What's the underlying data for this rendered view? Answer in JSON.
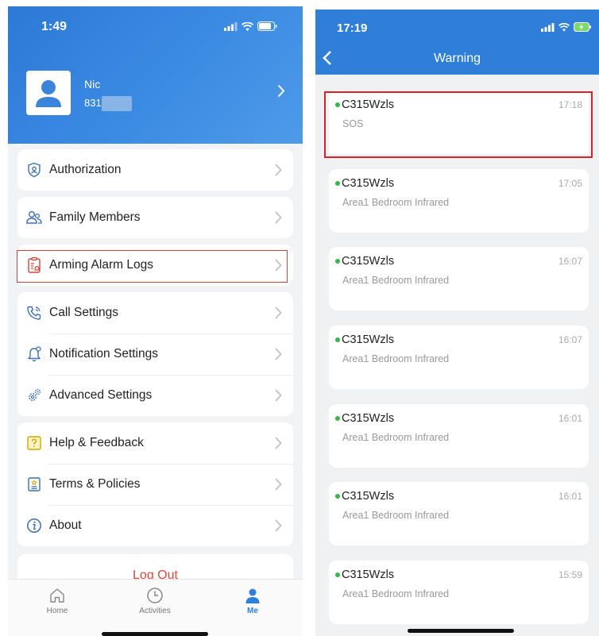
{
  "left": {
    "status_time": "1:49",
    "profile": {
      "name": "Nic",
      "id": "831"
    },
    "menu": [
      {
        "label": "Authorization",
        "icon": "shield-user-icon"
      },
      {
        "label": "Family Members",
        "icon": "family-icon"
      },
      {
        "label": "Arming Alarm Logs",
        "icon": "alarm-log-icon"
      },
      {
        "label": "Call Settings",
        "icon": "phone-icon"
      },
      {
        "label": "Notification Settings",
        "icon": "bell-icon"
      },
      {
        "label": "Advanced Settings",
        "icon": "gears-icon"
      },
      {
        "label": "Help & Feedback",
        "icon": "help-icon"
      },
      {
        "label": "Terms & Policies",
        "icon": "document-icon"
      },
      {
        "label": "About",
        "icon": "info-icon"
      }
    ],
    "logout": "Log Out",
    "tabs": [
      {
        "label": "Home",
        "icon": "home-icon"
      },
      {
        "label": "Activities",
        "icon": "clock-icon"
      },
      {
        "label": "Me",
        "icon": "person-icon"
      }
    ],
    "colors": {
      "brand": "#2f7ed8",
      "highlight": "#d8413a",
      "logout": "#e0463c"
    }
  },
  "right": {
    "status_time": "17:19",
    "title": "Warning",
    "warnings": [
      {
        "device": "C315Wzls",
        "time": "17:18",
        "desc": "SOS"
      },
      {
        "device": "C315Wzls",
        "time": "17:05",
        "desc": "Area1 Bedroom Infrared"
      },
      {
        "device": "C315Wzls",
        "time": "16:07",
        "desc": "Area1 Bedroom Infrared"
      },
      {
        "device": "C315Wzls",
        "time": "16:07",
        "desc": "Area1 Bedroom Infrared"
      },
      {
        "device": "C315Wzls",
        "time": "16:01",
        "desc": "Area1 Bedroom Infrared"
      },
      {
        "device": "C315Wzls",
        "time": "16:01",
        "desc": "Area1 Bedroom Infrared"
      },
      {
        "device": "C315Wzls",
        "time": "15:59",
        "desc": "Area1 Bedroom Infrared"
      }
    ],
    "colors": {
      "online_dot": "#39b54a"
    }
  }
}
